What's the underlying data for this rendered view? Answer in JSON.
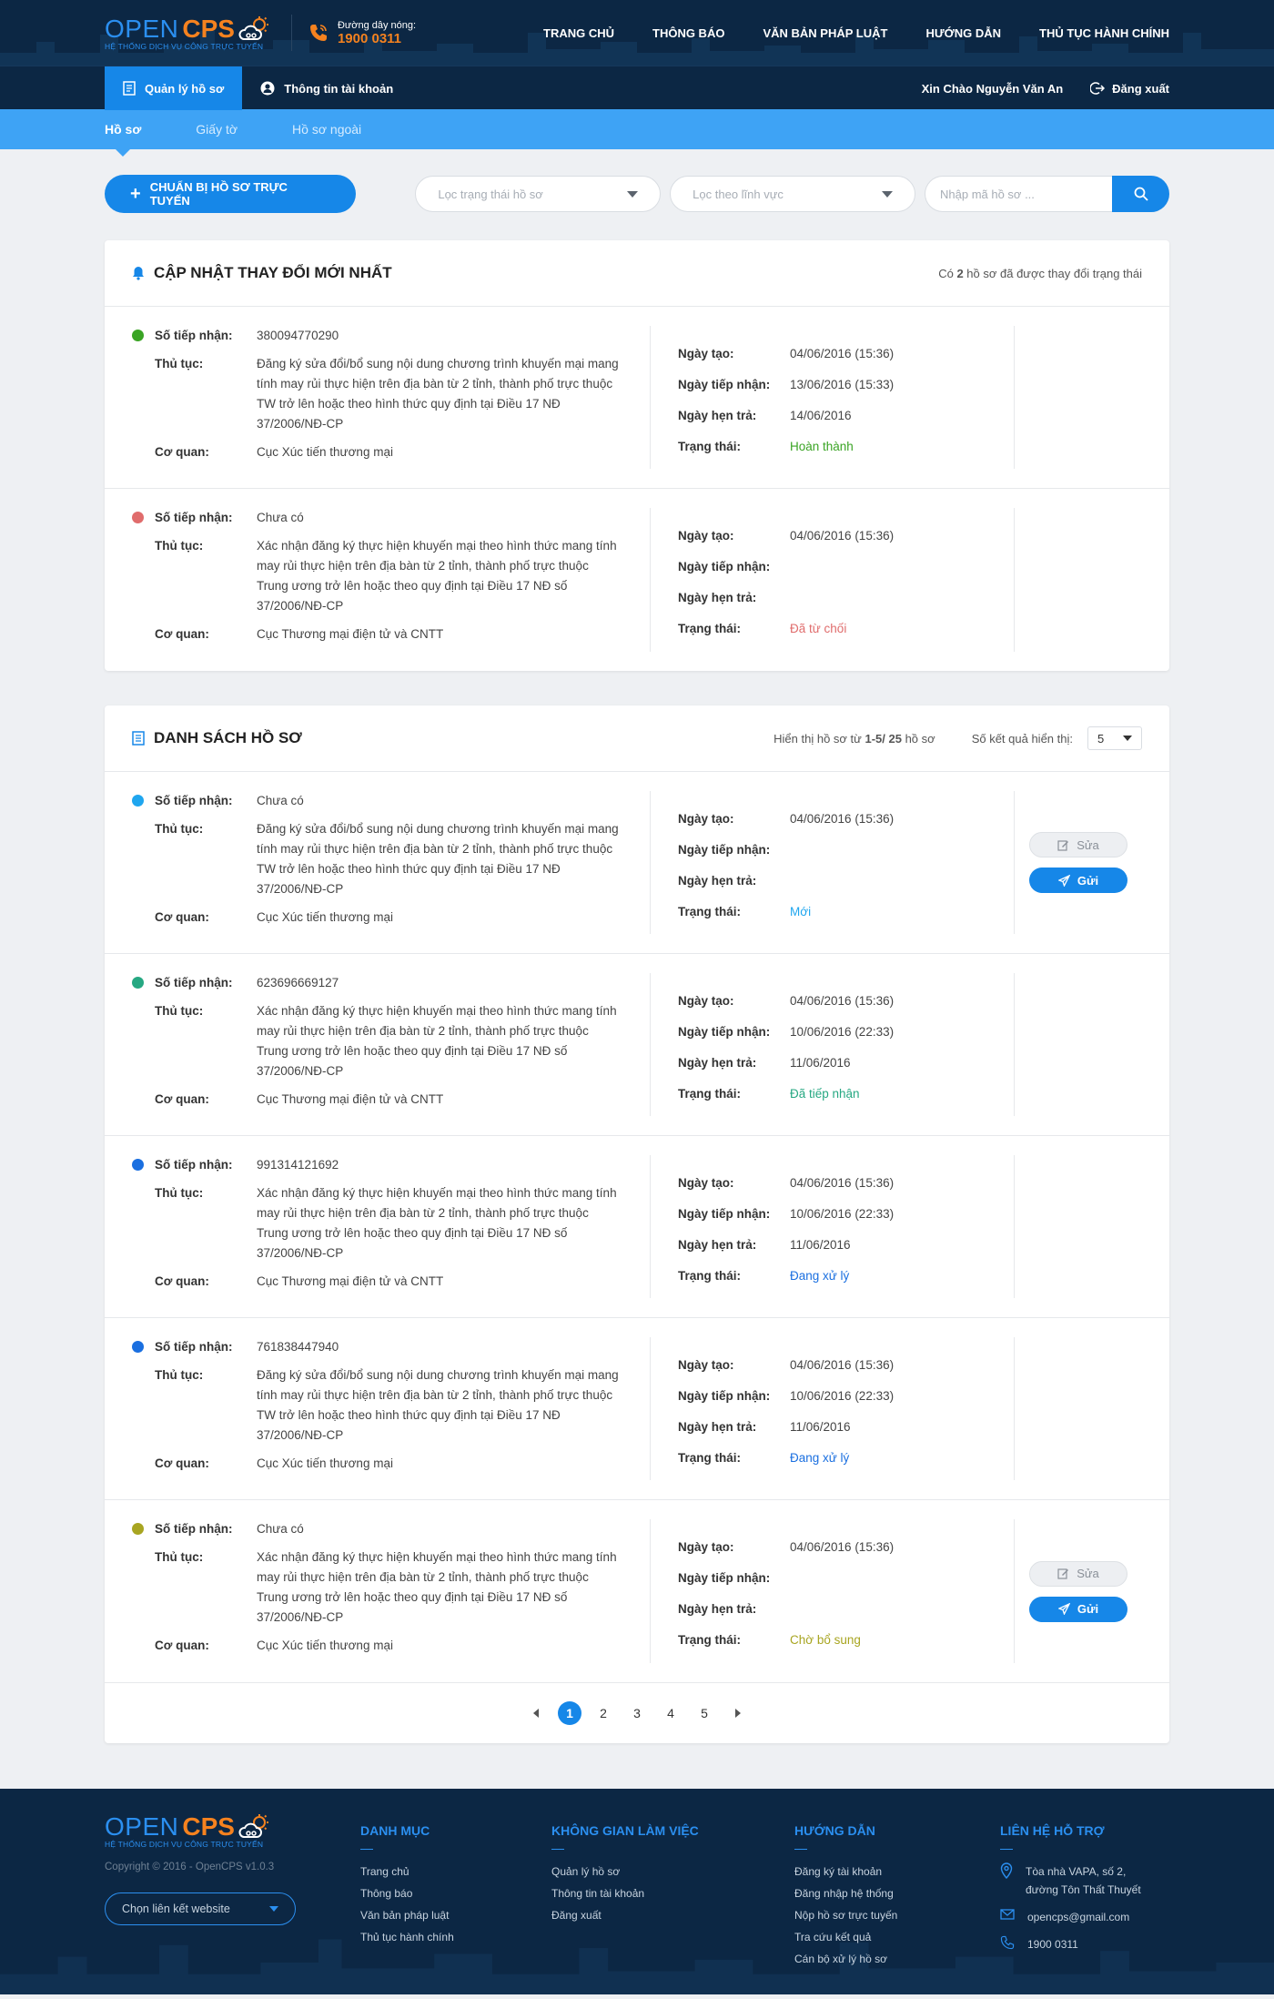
{
  "header": {
    "logo_open": "OPEN",
    "logo_cps": "CPS",
    "logo_sub": "HỆ THỐNG DỊCH VỤ CÔNG TRỰC TUYẾN",
    "hotline_label": "Đường dây nóng:",
    "hotline_number": "1900 0311",
    "nav": [
      "TRANG CHỦ",
      "THÔNG BÁO",
      "VĂN BẢN PHÁP LUẬT",
      "HƯỚNG DẪN",
      "THỦ TỤC HÀNH CHÍNH"
    ]
  },
  "subnav": {
    "tabs": [
      "Quản lý hồ sơ",
      "Thông tin tài khoản"
    ],
    "greeting": "Xin Chào Nguyễn Văn An",
    "logout": "Đăng xuất"
  },
  "tabs": [
    "Hồ sơ",
    "Giấy tờ",
    "Hồ sơ ngoài"
  ],
  "toolbar": {
    "prepare_button": "CHUẨN BỊ HỒ SƠ TRỰC TUYẾN",
    "status_filter_placeholder": "Lọc trạng thái hồ sơ",
    "field_filter_placeholder": "Lọc theo lĩnh vực",
    "search_placeholder": "Nhập mã hồ sơ ..."
  },
  "labels": {
    "receipt_no": "Số tiếp nhận:",
    "procedure": "Thủ tục:",
    "agency": "Cơ quan:",
    "created": "Ngày tạo:",
    "received": "Ngày tiếp nhận:",
    "due": "Ngày hẹn trả:",
    "status": "Trạng thái:",
    "edit": "Sửa",
    "send": "Gửi"
  },
  "updates": {
    "title": "CẬP NHẬT THAY ĐỔI MỚI NHẤT",
    "meta_prefix": "Có ",
    "meta_count": "2",
    "meta_suffix": " hồ sơ đã được thay đổi trạng thái",
    "records": [
      {
        "dot_color": "#3aa424",
        "receipt_no": "380094770290",
        "procedure": "Đăng ký sửa đổi/bổ sung nội dung chương trình khuyến mại mang tính may rủi thực hiện trên địa bàn từ 2 tỉnh, thành phố trực thuộc TW trở lên hoặc theo hình thức quy định tại Điều 17 NĐ 37/2006/NĐ-CP",
        "agency": "Cục Xúc tiến thương mại",
        "created": "04/06/2016 (15:36)",
        "received": "13/06/2016 (15:33)",
        "due": "14/06/2016",
        "status": "Hoàn thành",
        "status_color": "#3aa424",
        "actions": false
      },
      {
        "dot_color": "#e06c6c",
        "receipt_no": "Chưa có",
        "procedure": "Xác nhận đăng ký thực hiện khuyến mại theo hình thức mang tính may rủi thực hiện trên địa bàn từ 2 tỉnh, thành phố trực thuộc Trung ương trở lên hoặc theo quy định tại Điều 17 NĐ số 37/2006/NĐ-CP",
        "agency": "Cục Thương mại điện tử và CNTT",
        "created": "04/06/2016 (15:36)",
        "received": "",
        "due": "",
        "status": "Đã từ chối",
        "status_color": "#e06c6c",
        "actions": false
      }
    ]
  },
  "list": {
    "title": "DANH SÁCH HỒ SƠ",
    "showing_prefix": "Hiển thị hồ sơ từ ",
    "showing_range": "1-5/ 25",
    "showing_suffix": " hồ sơ",
    "perpage_label": "Số kết quả hiển thị:",
    "perpage_value": "5",
    "records": [
      {
        "dot_color": "#1fa6ef",
        "receipt_no": "Chưa có",
        "procedure": "Đăng ký sửa đổi/bổ sung nội dung chương trình khuyến mại mang tính may rủi thực hiện trên địa bàn từ 2 tỉnh, thành phố trực thuộc TW trở lên hoặc theo hình thức quy định tại Điều 17 NĐ 37/2006/NĐ-CP",
        "agency": "Cục Xúc tiến thương mại",
        "created": "04/06/2016 (15:36)",
        "received": "",
        "due": "",
        "status": "Mới",
        "status_color": "#1fa6ef",
        "actions": true
      },
      {
        "dot_color": "#26a882",
        "receipt_no": "623696669127",
        "procedure": "Xác nhận đăng ký thực hiện khuyến mại theo hình thức mang tính may rủi thực hiện trên địa bàn từ 2 tỉnh, thành phố trực thuộc Trung ương trở lên hoặc theo quy định tại Điều 17 NĐ số 37/2006/NĐ-CP",
        "agency": "Cục Thương mại điện tử và CNTT",
        "created": "04/06/2016 (15:36)",
        "received": "10/06/2016 (22:33)",
        "due": "11/06/2016",
        "status": "Đã tiếp nhận",
        "status_color": "#26a882",
        "actions": false
      },
      {
        "dot_color": "#1a6fe0",
        "receipt_no": "991314121692",
        "procedure": "Xác nhận đăng ký thực hiện khuyến mại theo hình thức mang tính may rủi thực hiện trên địa bàn từ 2 tỉnh, thành phố trực thuộc Trung ương trở lên hoặc theo quy định tại Điều 17 NĐ số 37/2006/NĐ-CP",
        "agency": "Cục Thương mại điện tử và CNTT",
        "created": "04/06/2016 (15:36)",
        "received": "10/06/2016 (22:33)",
        "due": "11/06/2016",
        "status": "Đang xử lý",
        "status_color": "#1a6fe0",
        "actions": false
      },
      {
        "dot_color": "#1a6fe0",
        "receipt_no": "761838447940",
        "procedure": "Đăng ký sửa đổi/bổ sung nội dung chương trình khuyến mại mang tính may rủi thực hiện trên địa bàn từ 2 tỉnh, thành phố trực thuộc TW trở lên hoặc theo hình thức quy định tại Điều 17 NĐ 37/2006/NĐ-CP",
        "agency": "Cục Xúc tiến thương mại",
        "created": "04/06/2016 (15:36)",
        "received": "10/06/2016 (22:33)",
        "due": "11/06/2016",
        "status": "Đang xử lý",
        "status_color": "#1a6fe0",
        "actions": false
      },
      {
        "dot_color": "#a8a521",
        "receipt_no": "Chưa có",
        "procedure": "Xác nhận đăng ký thực hiện khuyến mại theo hình thức mang tính may rủi thực hiện trên địa bàn từ 2 tỉnh, thành phố trực thuộc Trung ương trở lên hoặc theo quy định tại Điều 17 NĐ số 37/2006/NĐ-CP",
        "agency": "Cục Xúc tiến thương mại",
        "created": "04/06/2016 (15:36)",
        "received": "",
        "due": "",
        "status": "Chờ bổ sung",
        "status_color": "#a8a521",
        "actions": true
      }
    ],
    "pages": [
      "1",
      "2",
      "3",
      "4",
      "5"
    ],
    "current_page": "1"
  },
  "footer": {
    "copyright": "Copyright © 2016 - OpenCPS v1.0.3",
    "link_select": "Chọn liên kết website",
    "columns": [
      {
        "title": "DANH MỤC",
        "items": [
          "Trang chủ",
          "Thông báo",
          "Văn bản pháp luật",
          "Thủ tục hành chính"
        ]
      },
      {
        "title": "KHÔNG GIAN LÀM VIỆC",
        "items": [
          "Quản lý hồ sơ",
          "Thông tin tài khoản",
          "Đăng xuất"
        ]
      },
      {
        "title": "HƯỚNG DẪN",
        "items": [
          "Đăng ký tài khoản",
          "Đăng nhập hệ thống",
          "Nộp hồ sơ trực tuyến",
          "Tra cứu kết quả",
          "Cán bộ xử lý hồ sơ"
        ]
      }
    ],
    "contact_title": "LIÊN HỆ HỖ TRỢ",
    "address": "Tòa nhà VAPA, số 2, đường Tôn Thất Thuyết",
    "email": "opencps@gmail.com",
    "phone": "1900 0311"
  },
  "colors": {
    "primary": "#1687e8",
    "navy": "#0c2744",
    "orange": "#f5821f",
    "tabbar": "#3ea3f5"
  }
}
